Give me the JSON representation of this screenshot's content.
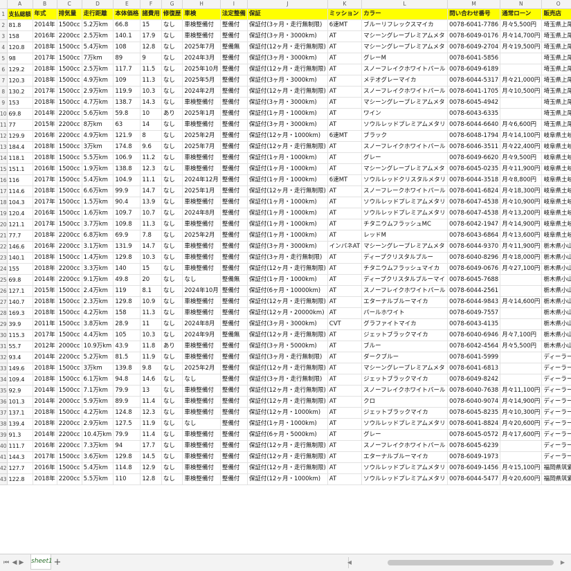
{
  "columns": [
    "A",
    "B",
    "C",
    "D",
    "E",
    "F",
    "G",
    "H",
    "I",
    "J",
    "K",
    "L",
    "M",
    "N",
    "O"
  ],
  "header": [
    "支払総額",
    "年式",
    "排気量",
    "走行距離",
    "本体価格",
    "諸費用",
    "修復歴",
    "車検",
    "法定整備",
    "保証",
    "ミッション",
    "カラー",
    "問い合わせ番号",
    "通常ローン",
    "販売店"
  ],
  "rows": [
    [
      "81.8",
      "2014年",
      "1500cc",
      "5.2万km",
      "66.8",
      "15",
      "なし",
      "車検整備付",
      "整備付",
      "保証付(3ヶ月・走行無制限)",
      "6速MT",
      "ブルーリフレックスマイカ",
      "0078-6041-7786",
      "月々5,500円",
      "埼玉県上尾"
    ],
    [
      "158",
      "2016年",
      "2200cc",
      "2.5万km",
      "140.1",
      "17.9",
      "なし",
      "車検整備付",
      "整備付",
      "保証付(3ヶ月・3000km)",
      "AT",
      "マシーングレープレミアムメタ",
      "0078-6049-0176",
      "月々14,700円",
      "埼玉県上尾"
    ],
    [
      "120.8",
      "2018年",
      "1500cc",
      "5.4万km",
      "108",
      "12.8",
      "なし",
      "2025年7月",
      "整備無",
      "保証付(12ヶ月・走行無制限)",
      "AT",
      "マシーングレープレミアムメタ",
      "0078-6049-2704",
      "月々19,500円",
      "埼玉県上尾"
    ],
    [
      "98",
      "2017年",
      "1500cc",
      "7万km",
      "89",
      "9",
      "なし",
      "2024年3月",
      "整備付",
      "保証付(3ヶ月・3000km)",
      "AT",
      "グレーM",
      "0078-6041-5856",
      "",
      "埼玉県上尾"
    ],
    [
      "129.2",
      "2018年",
      "1500cc",
      "2.5万km",
      "117.7",
      "11.5",
      "なし",
      "2025年10月",
      "整備付",
      "保証付(12ヶ月・走行無制限)",
      "AT",
      "スノーフレイクホワイトパール",
      "0078-6049-6189",
      "",
      "埼玉県上尾"
    ],
    [
      "120.3",
      "2018年",
      "1500cc",
      "4.9万km",
      "109",
      "11.3",
      "なし",
      "2025年5月",
      "整備付",
      "保証付(3ヶ月・3000km)",
      "AT",
      "メテオグレーマイカ",
      "0078-6044-5317",
      "月々21,000円",
      "埼玉県上尾"
    ],
    [
      "130.2",
      "2017年",
      "1500cc",
      "2.9万km",
      "119.9",
      "10.3",
      "なし",
      "2024年2月",
      "整備付",
      "保証付(12ヶ月・走行無制限)",
      "AT",
      "スノーフレイクホワイトパール",
      "0078-6041-1705",
      "月々10,500円",
      "埼玉県上尾"
    ],
    [
      "153",
      "2018年",
      "1500cc",
      "4.7万km",
      "138.7",
      "14.3",
      "なし",
      "車検整備付",
      "整備付",
      "保証付(3ヶ月・3000km)",
      "AT",
      "マシーングレープレミアムメタ",
      "0078-6045-4942",
      "",
      "埼玉県上尾"
    ],
    [
      "69.8",
      "2014年",
      "2200cc",
      "5.6万km",
      "59.8",
      "10",
      "あり",
      "2025年1月",
      "整備付",
      "保証付(1ヶ月・1000km)",
      "AT",
      "ワイン",
      "0078-6043-6335",
      "",
      "埼玉県上尾"
    ],
    [
      "77",
      "2015年",
      "2200cc",
      "8万km",
      "63",
      "14",
      "なし",
      "車検整備付",
      "整備付",
      "保証付(3ヶ月・3000km)",
      "AT",
      "ソウルレッドプレミアムメタリ",
      "0078-6044-6640",
      "月々6,600円",
      "埼玉県上尾"
    ],
    [
      "129.9",
      "2016年",
      "2200cc",
      "4.9万km",
      "121.9",
      "8",
      "なし",
      "2025年2月",
      "整備付",
      "保証付(12ヶ月・1000km)",
      "6速MT",
      "ブラック",
      "0078-6048-1794",
      "月々14,100円",
      "岐阜県土岐"
    ],
    [
      "184.4",
      "2018年",
      "1500cc",
      "3万km",
      "174.8",
      "9.6",
      "なし",
      "2025年7月",
      "整備付",
      "保証付(12ヶ月・走行無制限)",
      "AT",
      "スノーフレイクホワイトパール",
      "0078-6046-3511",
      "月々22,400円",
      "岐阜県土岐"
    ],
    [
      "118.1",
      "2018年",
      "1500cc",
      "5.5万km",
      "106.9",
      "11.2",
      "なし",
      "車検整備付",
      "整備付",
      "保証付(1ヶ月・1000km)",
      "AT",
      "グレー",
      "0078-6049-6620",
      "月々9,500円",
      "岐阜県土岐"
    ],
    [
      "151.1",
      "2016年",
      "1500cc",
      "1.9万km",
      "138.8",
      "12.3",
      "なし",
      "車検整備付",
      "整備付",
      "保証付(1ヶ月・1000km)",
      "AT",
      "マシーングレープレミアムメタ",
      "0078-6045-0235",
      "月々11,900円",
      "岐阜県土岐"
    ],
    [
      "116",
      "2017年",
      "1500cc",
      "5.4万km",
      "104.9",
      "11.1",
      "なし",
      "2024年12月",
      "整備付",
      "保証付(1ヶ月・1000km)",
      "6速MT",
      "ソウルレッドクリスタルメタリ",
      "0078-6044-3518",
      "月々8,800円",
      "岐阜県土岐"
    ],
    [
      "114.6",
      "2018年",
      "1500cc",
      "6.6万km",
      "99.9",
      "14.7",
      "なし",
      "2025年1月",
      "整備付",
      "保証付(12ヶ月・走行無制限)",
      "AT",
      "スノーフレークホワイトパール",
      "0078-6041-6824",
      "月々18,300円",
      "岐阜県土岐"
    ],
    [
      "104.3",
      "2017年",
      "1500cc",
      "1.5万km",
      "90.4",
      "13.9",
      "なし",
      "車検整備付",
      "整備付",
      "保証付(1ヶ月・1000km)",
      "AT",
      "ソウルレッドプレミアムメタリ",
      "0078-6047-4538",
      "月々10,900円",
      "岐阜県土岐"
    ],
    [
      "120.4",
      "2016年",
      "1500cc",
      "1.6万km",
      "109.7",
      "10.7",
      "なし",
      "2024年8月",
      "整備付",
      "保証付(1ヶ月・1000km)",
      "AT",
      "ソウルレッドプレミアムメタリ",
      "0078-6047-4538",
      "月々13,200円",
      "岐阜県土岐"
    ],
    [
      "121.1",
      "2017年",
      "1500cc",
      "3.7万km",
      "109.8",
      "11.3",
      "なし",
      "車検整備付",
      "整備付",
      "保証付(1ヶ月・1000km)",
      "AT",
      "チタニウムフラッシュMC",
      "0078-6042-1947",
      "月々14,900円",
      "岐阜県土岐"
    ],
    [
      "77.7",
      "2018年",
      "2200cc",
      "6.8万km",
      "69.9",
      "7.8",
      "なし",
      "2025年2月",
      "整備付",
      "保証付(1ヶ月・1000km)",
      "AT",
      "レッドM",
      "0078-6043-6864",
      "月々13,600円",
      "岐阜県土岐"
    ],
    [
      "146.6",
      "2016年",
      "2200cc",
      "3.1万km",
      "131.9",
      "14.7",
      "なし",
      "車検整備付",
      "整備付",
      "保証付(3ヶ月・3000km)",
      "インパネAT",
      "マシーングレープレミアムメタ",
      "0078-6044-9370",
      "月々11,900円",
      "栃木県小山"
    ],
    [
      "140.1",
      "2018年",
      "1500cc",
      "1.4万km",
      "129.8",
      "10.3",
      "なし",
      "車検整備付",
      "整備付",
      "保証付(3ヶ月・走行無制限)",
      "AT",
      "ディープクリスタルブルー",
      "0078-6040-8296",
      "月々18,000円",
      "栃木県小山"
    ],
    [
      "155",
      "2018年",
      "2200cc",
      "3.3万km",
      "140",
      "15",
      "なし",
      "車検整備付",
      "整備付",
      "保証付(12ヶ月・走行無制限)",
      "AT",
      "チタニウムフラッシュマイカ",
      "0078-6049-0676",
      "月々27,100円",
      "栃木県小山"
    ],
    [
      "69.8",
      "2014年",
      "2200cc",
      "9.1万km",
      "49.8",
      "20",
      "なし",
      "なし",
      "整備無",
      "保証付(1ヶ月・1000km)",
      "AT",
      "ディープクリスタルブルーマイ",
      "0078-6045-7688",
      "",
      "栃木県小山"
    ],
    [
      "127.1",
      "2015年",
      "1500cc",
      "2.4万km",
      "119",
      "8.1",
      "なし",
      "2024年10月",
      "整備付",
      "保証付(6ヶ月・10000km)",
      "AT",
      "スノーフレイクホワイトパール",
      "0078-6044-2561",
      "",
      "栃木県小山"
    ],
    [
      "140.7",
      "2018年",
      "1500cc",
      "2.3万km",
      "129.8",
      "10.9",
      "なし",
      "車検整備付",
      "整備付",
      "保証付(12ヶ月・走行無制限)",
      "AT",
      "エターナルブルーマイカ",
      "0078-6044-9843",
      "月々14,600円",
      "栃木県小山"
    ],
    [
      "169.3",
      "2018年",
      "1500cc",
      "4.2万km",
      "158",
      "11.3",
      "なし",
      "車検整備付",
      "整備付",
      "保証付(12ヶ月・20000km)",
      "AT",
      "パールホワイト",
      "0078-6049-7557",
      "",
      "栃木県小山"
    ],
    [
      "39.9",
      "2011年",
      "1500cc",
      "3.8万km",
      "28.9",
      "11",
      "なし",
      "2024年8月",
      "整備付",
      "保証付(3ヶ月・3000km)",
      "CVT",
      "グラファイトマイカ",
      "0078-6043-4135",
      "",
      "栃木県小山"
    ],
    [
      "115.3",
      "2017年",
      "1500cc",
      "4.4万km",
      "105",
      "10.3",
      "なし",
      "2024年9月",
      "整備無",
      "保証付(12ヶ月・走行無制限)",
      "AT",
      "ジェットブラックマイカ",
      "0078-6040-6946",
      "月々7,100円",
      "栃木県小山"
    ],
    [
      "55.7",
      "2012年",
      "2000cc",
      "10.9万km",
      "43.9",
      "11.8",
      "あり",
      "車検整備付",
      "整備付",
      "保証付(3ヶ月・5000km)",
      "AT",
      "ブルー",
      "0078-6042-4564",
      "月々5,500円",
      "栃木県小山"
    ],
    [
      "93.4",
      "2014年",
      "2200cc",
      "5.2万km",
      "81.5",
      "11.9",
      "なし",
      "車検整備付",
      "整備付",
      "保証付(3ヶ月・走行無制限)",
      "AT",
      "ダークブルー",
      "0078-6041-5999",
      "",
      "ディーラー"
    ],
    [
      "149.6",
      "2018年",
      "1500cc",
      "3万km",
      "139.8",
      "9.8",
      "なし",
      "2025年2月",
      "整備付",
      "保証付(12ヶ月・走行無制限)",
      "AT",
      "マシーングレープレミアムメタ",
      "0078-6041-6813",
      "",
      "ディーラー"
    ],
    [
      "109.4",
      "2018年",
      "1500cc",
      "6.1万km",
      "94.8",
      "14.6",
      "なし",
      "なし",
      "整備付",
      "保証付(3ヶ月・走行無制限)",
      "AT",
      "ジェットブラックマイカ",
      "0078-6049-8242",
      "",
      "ディーラー"
    ],
    [
      "92.9",
      "2014年",
      "1500cc",
      "7.1万km",
      "79.9",
      "13",
      "なし",
      "車検整備付",
      "整備付",
      "保証付(12ヶ月・走行無制限)",
      "AT",
      "スノーフレイクホワイトパール",
      "0078-6040-7638",
      "月々11,100円",
      "ディーラー"
    ],
    [
      "101.3",
      "2014年",
      "2000cc",
      "5.9万km",
      "89.9",
      "11.4",
      "なし",
      "車検整備付",
      "整備付",
      "保証付(12ヶ月・走行無制限)",
      "AT",
      "クロ",
      "0078-6040-9074",
      "月々14,900円",
      "ディーラー"
    ],
    [
      "137.1",
      "2018年",
      "1500cc",
      "4.2万km",
      "124.8",
      "12.3",
      "なし",
      "車検整備付",
      "整備付",
      "保証付(12ヶ月・1000km)",
      "AT",
      "ジェットブラックマイカ",
      "0078-6045-8235",
      "月々10,300円",
      "ディーラー"
    ],
    [
      "139.4",
      "2018年",
      "2200cc",
      "2.9万km",
      "127.5",
      "11.9",
      "なし",
      "なし",
      "整備付",
      "保証付(1ヶ月・1000km)",
      "AT",
      "ソウルレッドプレミアムメタリ",
      "0078-6041-8824",
      "月々20,600円",
      "ディーラー"
    ],
    [
      "91.3",
      "2014年",
      "2200cc",
      "10.4万km",
      "79.9",
      "11.4",
      "なし",
      "車検整備付",
      "整備付",
      "保証付(6ヶ月・5000km)",
      "AT",
      "グレー",
      "0078-6045-0572",
      "月々17,600円",
      "ディーラー"
    ],
    [
      "111.7",
      "2016年",
      "2200cc",
      "7.3万km",
      "94",
      "17.7",
      "なし",
      "車検整備付",
      "整備付",
      "保証付(12ヶ月・走行無制限)",
      "AT",
      "スノーフレイクホワイトパール",
      "0078-6045-6239",
      "",
      "ディーラー"
    ],
    [
      "144.3",
      "2017年",
      "1500cc",
      "3.6万km",
      "129.8",
      "14.5",
      "なし",
      "車検整備付",
      "整備付",
      "保証付(12ヶ月・走行無制限)",
      "AT",
      "エターナルブルーマイカ",
      "0078-6049-1973",
      "",
      "ディーラー"
    ],
    [
      "127.7",
      "2016年",
      "1500cc",
      "5.4万km",
      "114.8",
      "12.9",
      "なし",
      "車検整備付",
      "整備付",
      "保証付(12ヶ月・走行無制限)",
      "AT",
      "ソウルレッドプレミアムメタリ",
      "0078-6049-1456",
      "月々15,100円",
      "福岡県筑紫"
    ],
    [
      "122.8",
      "2018年",
      "2200cc",
      "5.5万km",
      "110",
      "12.8",
      "なし",
      "車検整備付",
      "整備付",
      "保証付(12ヶ月・1000km)",
      "AT",
      "ソウルレッドプレミアムメタリ",
      "0078-6044-5477",
      "月々20,600円",
      "福岡県筑紫"
    ]
  ],
  "footer": {
    "sheet_tab": "sheet1",
    "add_sheet": "+",
    "nav_first": "⏮",
    "nav_prev": "◀",
    "nav_next": "▶",
    "nav_last": "⏭"
  }
}
